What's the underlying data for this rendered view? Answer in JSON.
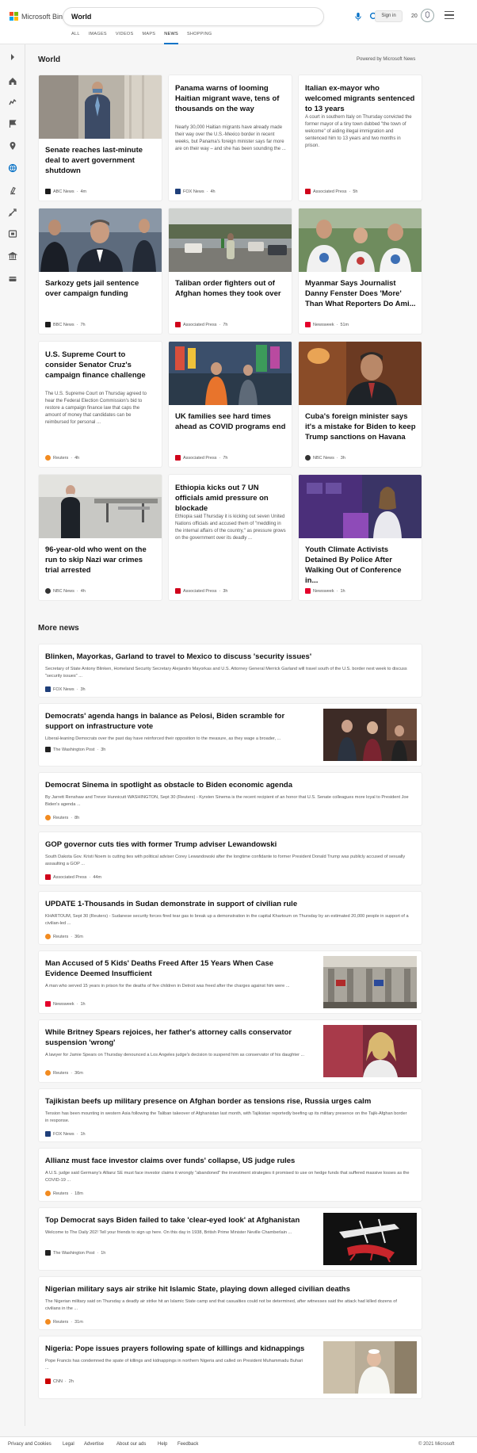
{
  "header": {
    "brand": "Microsoft Bing",
    "query": "World",
    "sign_in": "Sign in",
    "rewards_count": "20",
    "tabs": [
      "ALL",
      "IMAGES",
      "VIDEOS",
      "MAPS",
      "NEWS",
      "SHOPPING"
    ],
    "active_tab": "NEWS"
  },
  "section": {
    "title": "World",
    "powered_by": "Powered by Microsoft News"
  },
  "cards": [
    {
      "title": "Senate reaches last-minute deal to avert government shutdown",
      "snippet": "",
      "source": "ABC News",
      "time": "4m",
      "source_color": "#1c1c1c"
    },
    {
      "title": "Panama warns of looming Haitian migrant wave, tens of thousands on the way",
      "snippet": "Nearly 30,000 Haitian migrants have already made their way over the U.S.-Mexico border in recent weeks, but Panama's foreign minister says far more are on their way – and she has been sounding the ...",
      "source": "FOX News",
      "time": "4h",
      "source_color": "#1f3f7a"
    },
    {
      "title": "Italian ex-mayor who welcomed migrants sentenced to 13 years",
      "snippet": "A court in southern Italy on Thursday convicted the former mayor of a tiny town dubbed \"the town of welcome\" of aiding illegal immigration and sentenced him to 13 years and two months in prison.",
      "source": "Associated Press",
      "time": "5h",
      "source_color": "#d0021b"
    },
    {
      "title": "Sarkozy gets jail sentence over campaign funding",
      "snippet": "",
      "source": "BBC News",
      "time": "7h",
      "source_color": "#1c1c1c"
    },
    {
      "title": "Taliban order fighters out of Afghan homes they took over",
      "snippet": "",
      "source": "Associated Press",
      "time": "7h",
      "source_color": "#d0021b"
    },
    {
      "title": "Myanmar Says Journalist Danny Fenster Does 'More' Than What Reporters Do Ami...",
      "snippet": "",
      "source": "Newsweek",
      "time": "51m",
      "source_color": "#e4002b"
    },
    {
      "title": "U.S. Supreme Court to consider Senator Cruz's campaign finance challenge",
      "snippet": "The U.S. Supreme Court on Thursday agreed to hear the Federal Election Commission's bid to restore a campaign finance law that caps the amount of money that candidates can be reimbursed for personal ...",
      "source": "Reuters",
      "time": "4h",
      "source_color": "#f28b20"
    },
    {
      "title": "UK families see hard times ahead as COVID programs end",
      "snippet": "",
      "source": "Associated Press",
      "time": "7h",
      "source_color": "#d0021b"
    },
    {
      "title": "Cuba's foreign minister says it's a mistake for Biden to keep Trump sanctions on Havana",
      "snippet": "",
      "source": "NBC News",
      "time": "3h",
      "source_color": "#333333"
    },
    {
      "title": "96-year-old who went on the run to skip Nazi war crimes trial arrested",
      "snippet": "",
      "source": "NBC News",
      "time": "4h",
      "source_color": "#333333"
    },
    {
      "title": "Ethiopia kicks out 7 UN officials amid pressure on blockade",
      "snippet": "Ethiopia said Thursday it is kicking out seven United Nations officials and accused them of \"meddling in the internal affairs of the country,\" as pressure grows on the government over its deadly ...",
      "source": "Associated Press",
      "time": "3h",
      "source_color": "#d0021b"
    },
    {
      "title": "Youth Climate Activists Detained By Police After Walking Out of Conference in...",
      "snippet": "",
      "source": "Newsweek",
      "time": "1h",
      "source_color": "#e4002b"
    }
  ],
  "more": {
    "title": "More news",
    "items": [
      {
        "title": "Blinken, Mayorkas, Garland to travel to Mexico to discuss 'security issues'",
        "snippet": "Secretary of State Antony Blinken, Homeland Security Secretary Alejandro Mayorkas and U.S. Attorney General Merrick Garland will travel south of the U.S. border next week to discuss \"security issues\" ...",
        "source": "FOX News",
        "time": "3h",
        "source_color": "#1f3f7a"
      },
      {
        "title": "Democrats' agenda hangs in balance as Pelosi, Biden scramble for support on infrastructure vote",
        "snippet": "Liberal-leaning Democrats over the past day have reinforced their opposition to the measure, as they wage a broader, ...",
        "source": "The Washington Post",
        "time": "3h",
        "source_color": "#222222"
      },
      {
        "title": "Democrat Sinema in spotlight as obstacle to Biden economic agenda",
        "snippet": "By Jarrett Renshaw and Trevor Hunnicutt WASHINGTON, Sept 30 (Reuters) - Kyrsten Sinema is the recent recipient of an honor that U.S. Senate colleagues more loyal to President Joe Biden's agenda ...",
        "source": "Reuters",
        "time": "8h",
        "source_color": "#f28b20"
      },
      {
        "title": "GOP governor cuts ties with former Trump adviser Lewandowski",
        "snippet": "South Dakota Gov. Kristi Noem is cutting ties with political adviser Corey Lewandowski after the longtime confidante to former President Donald Trump was publicly accused of sexually assaulting a GOP ...",
        "source": "Associated Press",
        "time": "44m",
        "source_color": "#d0021b"
      },
      {
        "title": "UPDATE 1-Thousands in Sudan demonstrate in support of civilian rule",
        "snippet": "KHARTOUM, Sept 30 (Reuters) - Sudanese security forces fired tear gas to break up a demonstration in the capital Khartoum on Thursday by an estimated 20,000 people in support of a civilian-led ...",
        "source": "Reuters",
        "time": "36m",
        "source_color": "#f28b20"
      },
      {
        "title": "Man Accused of 5 Kids' Deaths Freed After 15 Years When Case Evidence Deemed Insufficient",
        "snippet": "A man who served 15 years in prison for the deaths of five children in Detroit was freed after the charges against him were ...",
        "source": "Newsweek",
        "time": "1h",
        "source_color": "#e4002b"
      },
      {
        "title": "While Britney Spears rejoices, her father's attorney calls conservator suspension 'wrong'",
        "snippet": "A lawyer for Jamie Spears on Thursday denounced a Los Angeles judge's decision to suspend him as conservator of his daughter ...",
        "source": "Reuters",
        "time": "36m",
        "source_color": "#f28b20"
      },
      {
        "title": "Tajikistan beefs up military presence on Afghan border as tensions rise, Russia urges calm",
        "snippet": "Tension has been mounting in western Asia following the Taliban takeover of Afghanistan last month, with Tajikistan reportedly beefing up its military presence on the Tajik-Afghan border in response.",
        "source": "FOX News",
        "time": "1h",
        "source_color": "#1f3f7a"
      },
      {
        "title": "Allianz must face investor claims over funds' collapse, US judge rules",
        "snippet": "A U.S. judge said Germany's Allianz SE must face investor claims it wrongly \"abandoned\" the investment strategies it promised to use on hedge funds that suffered massive losses as the COVID-19 ...",
        "source": "Reuters",
        "time": "18m",
        "source_color": "#f28b20"
      },
      {
        "title": "Top Democrat says Biden failed to take 'clear-eyed look' at Afghanistan",
        "snippet": "Welcome to The Daily 202! Tell your friends to sign up here. On this day in 1938, British Prime Minister Neville Chamberlain ...",
        "source": "The Washington Post",
        "time": "1h",
        "source_color": "#222222"
      },
      {
        "title": "Nigerian military says air strike hit Islamic State, playing down alleged civilian deaths",
        "snippet": "The Nigerian military said on Thursday a deadly air strike hit an Islamic State camp and that casualties could not be determined, after witnesses said the attack had killed dozens of civilians in the ...",
        "source": "Reuters",
        "time": "31m",
        "source_color": "#f28b20"
      },
      {
        "title": "Nigeria: Pope issues prayers following spate of killings and kidnappings",
        "snippet": "Pope Francis has condemned the spate of killings and kidnappings in northern Nigeria and called on President Muhammadu Buhari ...",
        "source": "CNN",
        "time": "2h",
        "source_color": "#cc0000"
      }
    ]
  },
  "footer": {
    "links": [
      "Privacy and Cookies",
      "Legal",
      "Advertise",
      "About our ads",
      "Help",
      "Feedback"
    ],
    "copyright": "© 2021 Microsoft"
  },
  "colors": {
    "accent": "#0a73c7",
    "background": "#f6f6f6"
  },
  "icons": {
    "sidebar": [
      "expand-icon",
      "home-icon",
      "us-icon",
      "flag-icon",
      "location-icon",
      "world-icon",
      "science-icon",
      "tech-icon",
      "entertainment-icon",
      "politics-icon",
      "money-icon"
    ]
  }
}
